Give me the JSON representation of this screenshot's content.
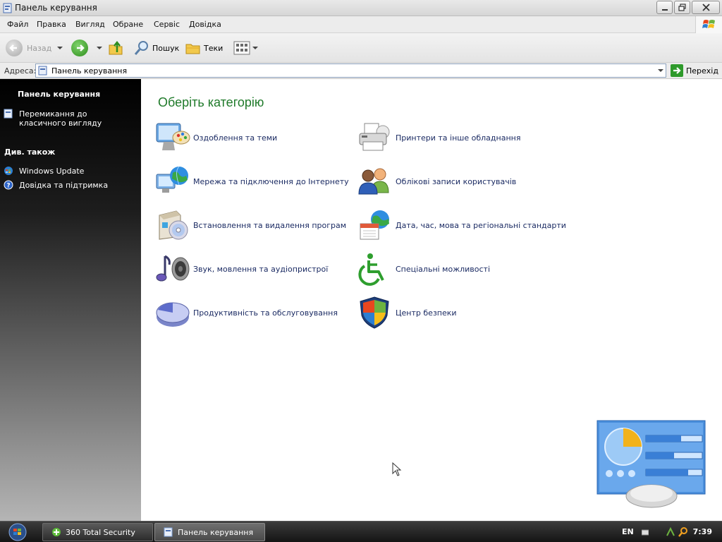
{
  "window": {
    "title": "Панель керування",
    "controls": [
      "minimize",
      "maximize",
      "close"
    ]
  },
  "menubar": {
    "items": [
      "Файл",
      "Правка",
      "Вигляд",
      "Обране",
      "Сервіс",
      "Довідка"
    ]
  },
  "toolbar": {
    "back_label": "Назад",
    "search_label": "Пошук",
    "folders_label": "Теки"
  },
  "address": {
    "label": "Адреса:",
    "value": "Панель керування",
    "go_label": "Перехід"
  },
  "sidebar": {
    "title": "Панель керування",
    "switch_view_label": "Перемикання до класичного вигляду",
    "see_also_title": "Див. також",
    "links": [
      {
        "label": "Windows Update",
        "icon": "windows-update-icon"
      },
      {
        "label": "Довідка та підтримка",
        "icon": "help-icon"
      }
    ]
  },
  "main": {
    "heading": "Оберіть категорію",
    "categories": [
      {
        "label": "Оздоблення та теми",
        "icon": "appearance-themes-icon"
      },
      {
        "label": "Принтери та інше обладнання",
        "icon": "printer-icon"
      },
      {
        "label": "Мережа та підключення до Інтернету",
        "icon": "network-icon"
      },
      {
        "label": "Облікові записи користувачів",
        "icon": "user-accounts-icon"
      },
      {
        "label": "Встановлення та видалення програм",
        "icon": "add-remove-programs-icon"
      },
      {
        "label": "Дата, час, мова та регіональні стандарти",
        "icon": "date-time-region-icon"
      },
      {
        "label": "Звук, мовлення та аудіопристрої",
        "icon": "sound-icon"
      },
      {
        "label": "Спеціальні можливості",
        "icon": "accessibility-icon"
      },
      {
        "label": "Продуктивність та обслуговування",
        "icon": "performance-icon"
      },
      {
        "label": "Центр безпеки",
        "icon": "security-center-icon"
      }
    ]
  },
  "taskbar": {
    "buttons": [
      {
        "label": "360 Total Security",
        "active": false
      },
      {
        "label": "Панель керування",
        "active": true
      }
    ],
    "language": "EN",
    "clock": "7:39"
  },
  "colors": {
    "heading_green": "#1f7a2a",
    "link_blue": "#1b2b63",
    "sidebar_black": "#000000"
  }
}
